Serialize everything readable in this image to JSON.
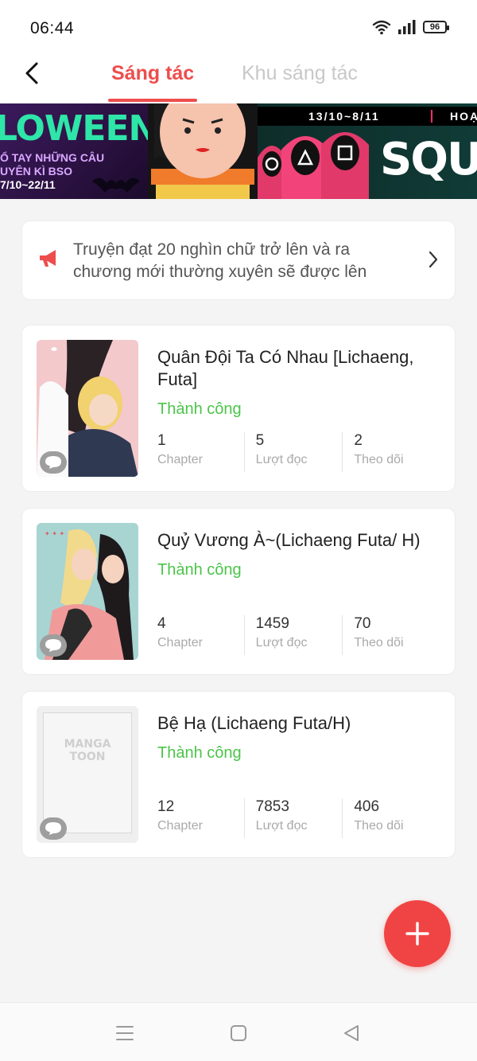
{
  "status_bar": {
    "time": "06:44",
    "battery": "96"
  },
  "header": {
    "tabs": [
      {
        "label": "Sáng tác",
        "active": true
      },
      {
        "label": "Khu sáng tác",
        "active": false
      }
    ]
  },
  "banner": {
    "left_title": "LOWEEN",
    "left_subtitle_1": "Ổ TAY NHỮNG CÂU",
    "left_subtitle_2": "UYÊN KÌ BSO",
    "left_dates": "7/10~22/11",
    "right_dates": "13/10~8/11",
    "right_tag": "HOẠT",
    "right_title": "SQUID"
  },
  "notice": {
    "text": "Truyện đạt 20 nghìn chữ trở lên và ra chương mới thường xuyên sẽ được lên"
  },
  "books": [
    {
      "title": "Quân Đội Ta Có Nhau [Lichaeng, Futa]",
      "status": "Thành công",
      "chapters": "1",
      "chapters_label": "Chapter",
      "reads": "5",
      "reads_label": "Lượt đọc",
      "follows": "2",
      "follows_label": "Theo dõi"
    },
    {
      "title": "Quỷ Vương À~(Lichaeng Futa/ H)",
      "status": "Thành công",
      "chapters": "4",
      "chapters_label": "Chapter",
      "reads": "1459",
      "reads_label": "Lượt đọc",
      "follows": "70",
      "follows_label": "Theo dõi"
    },
    {
      "title": "Bệ Hạ (Lichaeng Futa/H)",
      "status": "Thành công",
      "chapters": "12",
      "chapters_label": "Chapter",
      "reads": "7853",
      "reads_label": "Lượt đọc",
      "follows": "406",
      "follows_label": "Theo dõi",
      "placeholder_logo_1": "MANGA",
      "placeholder_logo_2": "TOON"
    }
  ],
  "colors": {
    "accent": "#ee4d4d",
    "success": "#4cc44a",
    "fab": "#f04444"
  },
  "icons": [
    "back-arrow-icon",
    "wifi-icon",
    "signal-icon",
    "battery-icon",
    "megaphone-icon",
    "chevron-right-icon",
    "comment-icon",
    "plus-icon",
    "menu-icon",
    "home-icon",
    "nav-back-icon"
  ]
}
